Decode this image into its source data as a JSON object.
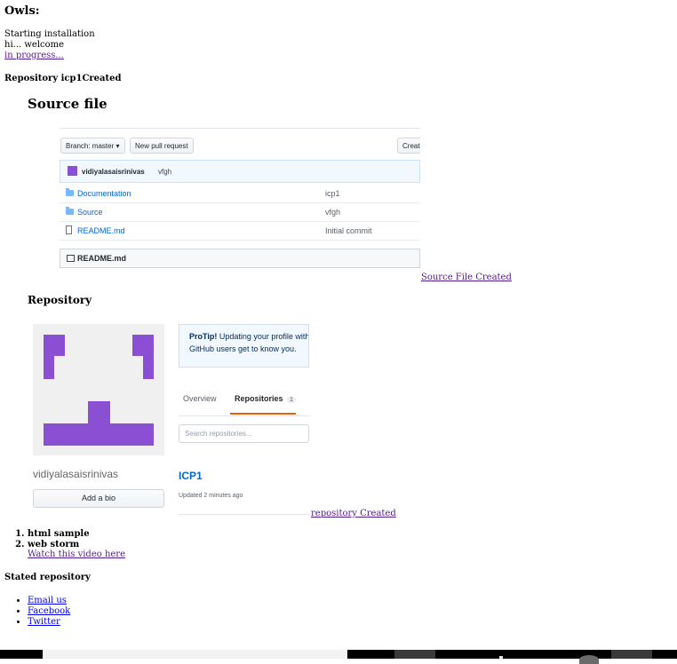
{
  "heading": "Owls:",
  "lines": [
    "Starting installation",
    "hi... welcome"
  ],
  "progress_link": "in progress...",
  "repo_created_text": "Repository icp1Created",
  "source_section_title": "Source file",
  "source_screenshot": {
    "branch_button": "Branch: master ▾",
    "pull_request_button": "New pull request",
    "create_button": "Creat",
    "commit_author": "vidiyalasaisrinivas",
    "commit_message": "vfgh",
    "files": [
      {
        "name": "Documentation",
        "message": "icp1",
        "type": "folder"
      },
      {
        "name": "Source",
        "message": "vfgh",
        "type": "folder"
      },
      {
        "name": "README.md",
        "message": "Initial commit",
        "type": "file"
      }
    ],
    "readme_header": "README.md"
  },
  "source_file_link": "Source File Created",
  "repository_section_title": "Repository",
  "repo_screenshot": {
    "username": "vidiyalasaisrinivas",
    "add_bio_button": "Add a bio",
    "protip_bold": "ProTip!",
    "protip_line1": " Updating your profile with",
    "protip_line2": "GitHub users get to know you.",
    "tab_overview": "Overview",
    "tab_repositories": "Repositories",
    "tab_repositories_count": "1",
    "search_placeholder": "Search repositories...",
    "repo_name": "ICP1",
    "repo_updated": "Updated 2 minutes ago",
    "avatar_color": "#8a4fd2",
    "link_color": "#0366d6"
  },
  "repository_created_link": "repository Created",
  "ordered_items": [
    "html sample",
    "web storm"
  ],
  "video_link": "Watch this video here",
  "stated_repository": "Stated repository",
  "footer_links": [
    "Email us",
    "Facebook",
    "Twitter"
  ]
}
